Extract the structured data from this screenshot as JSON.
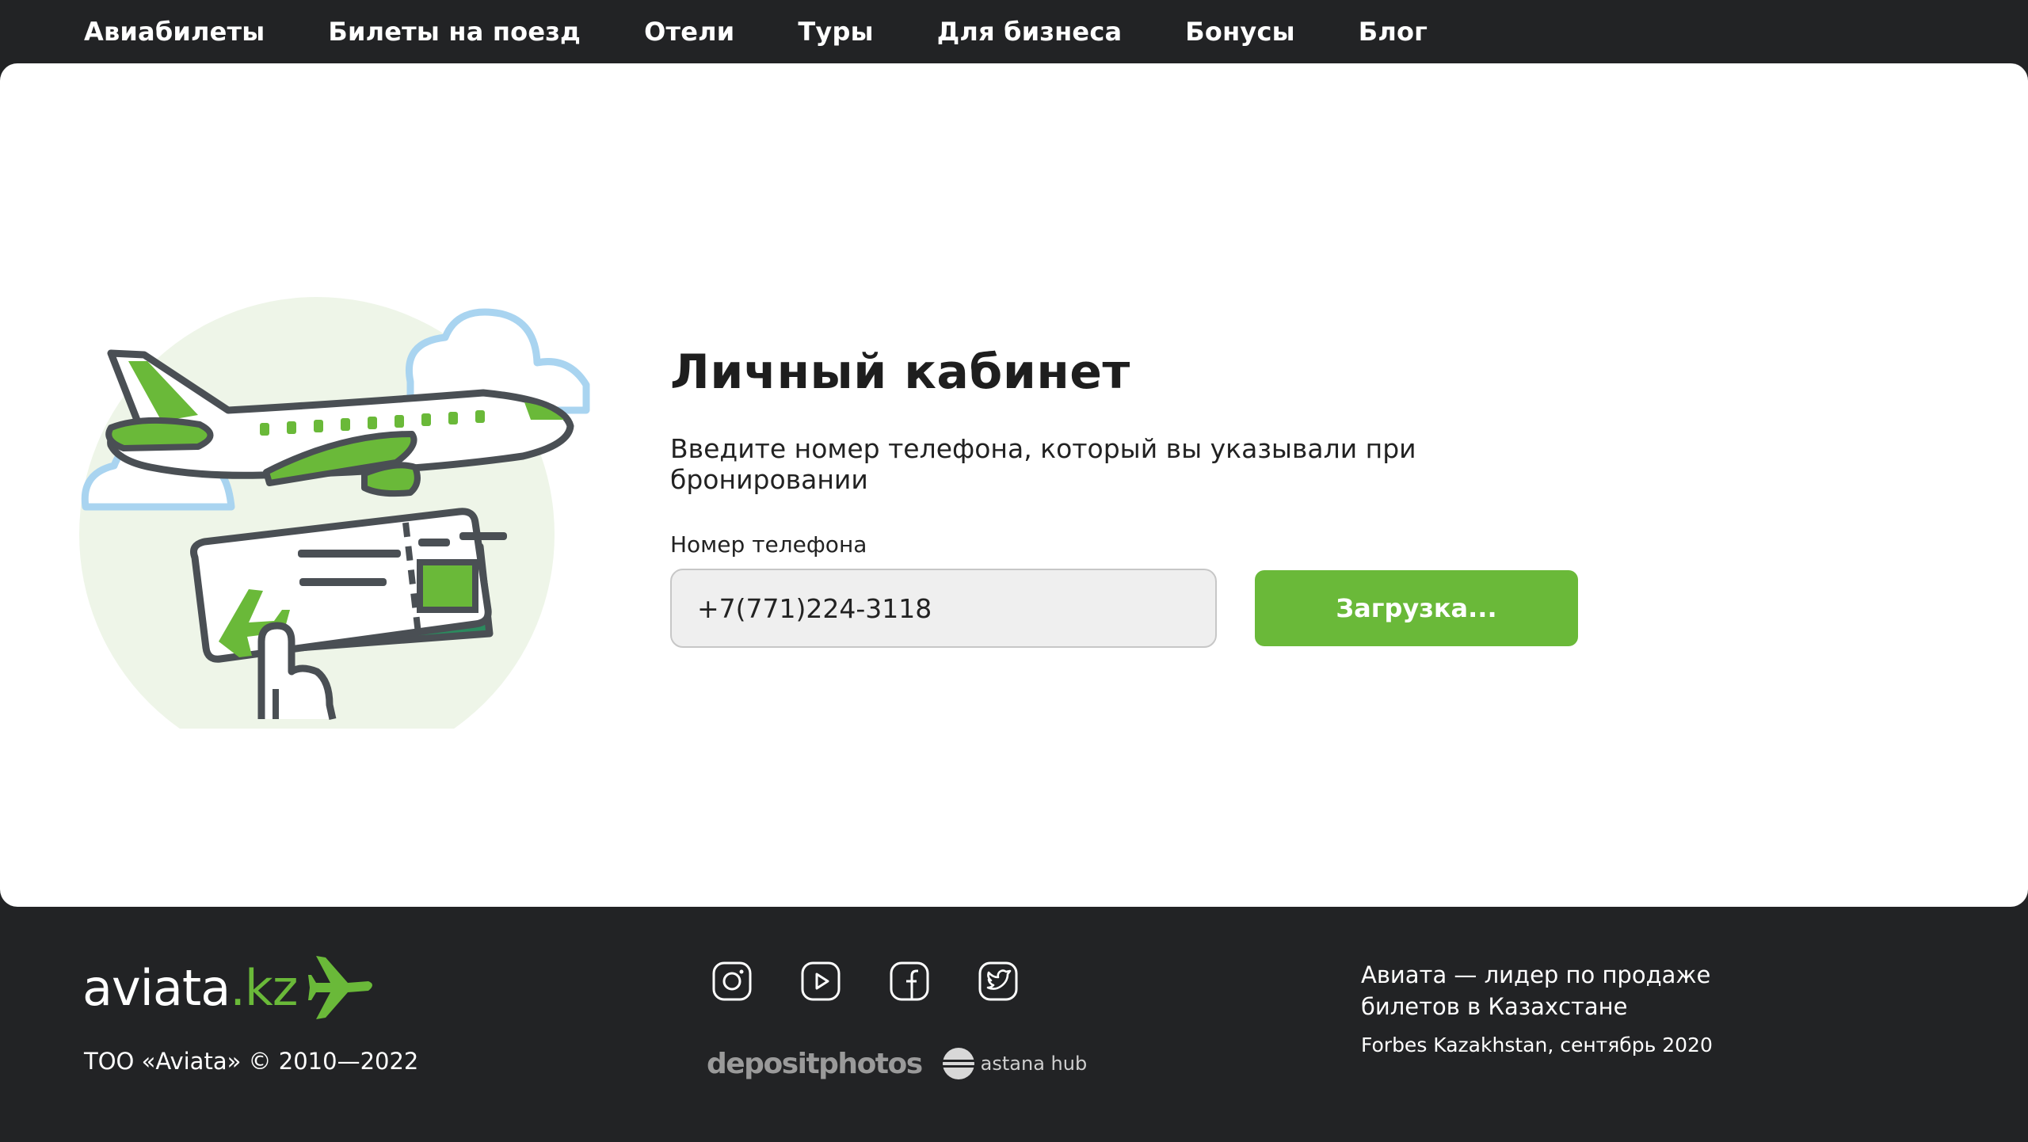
{
  "nav": {
    "items": [
      "Авиабилеты",
      "Билеты на поезд",
      "Отели",
      "Туры",
      "Для бизнеса",
      "Бонусы",
      "Блог"
    ]
  },
  "login": {
    "title": "Личный кабинет",
    "subtitle": "Введите номер телефона, который вы указывали при бронировании",
    "phone_label": "Номер телефона",
    "phone_value": "+7(771)224-3118",
    "submit_label": "Загрузка..."
  },
  "footer": {
    "logo_main": "aviata",
    "logo_suffix": ".kz",
    "copyright": "ТОО «Aviata» © 2010—2022",
    "socials": [
      "instagram-icon",
      "youtube-icon",
      "facebook-icon",
      "twitter-icon"
    ],
    "partners": [
      "depositphotos",
      "astana hub"
    ],
    "tagline": "Авиата — лидер по продаже билетов в Казахстане",
    "source": "Forbes Kazakhstan, сентябрь 2020"
  },
  "colors": {
    "accent": "#6ab939",
    "dark": "#222325",
    "cloud": "#a9d4f0",
    "circle_bg": "#eef5e8"
  }
}
